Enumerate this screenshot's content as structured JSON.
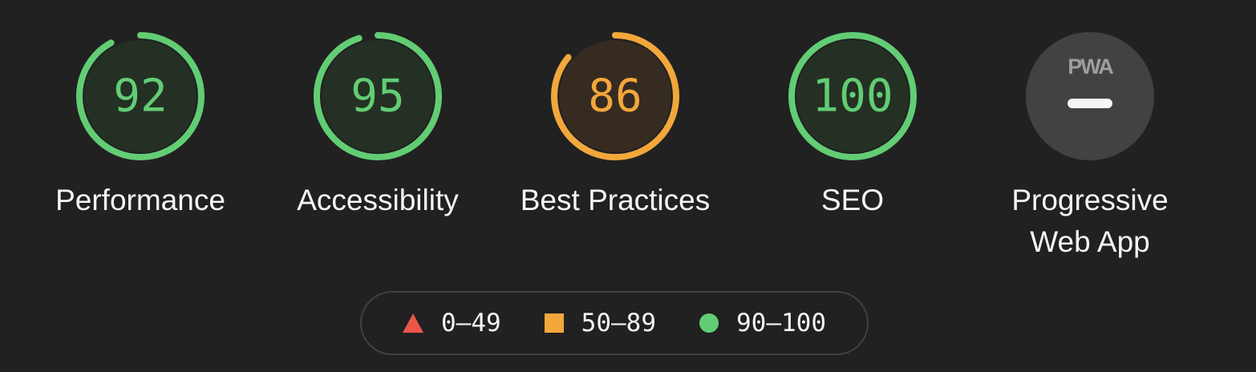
{
  "categories": [
    {
      "key": "performance",
      "label": "Performance",
      "score": 92,
      "display": "92",
      "color": "#62cd74",
      "fill": "#243024"
    },
    {
      "key": "accessibility",
      "label": "Accessibility",
      "score": 95,
      "display": "95",
      "color": "#62cd74",
      "fill": "#243024"
    },
    {
      "key": "best-practices",
      "label": "Best Practices",
      "score": 86,
      "display": "86",
      "color": "#f2a73b",
      "fill": "#352b21"
    },
    {
      "key": "seo",
      "label": "SEO",
      "score": 100,
      "display": "100",
      "color": "#62cd74",
      "fill": "#243024"
    }
  ],
  "pwa": {
    "label": "Progressive\nWeb App",
    "badge_text": "PWA",
    "status": "not-applicable",
    "color": "#424242"
  },
  "legend": [
    {
      "shape": "triangle",
      "range": "0–49",
      "color": "#eb5649"
    },
    {
      "shape": "square",
      "range": "50–89",
      "color": "#f2a73b"
    },
    {
      "shape": "circle",
      "range": "90–100",
      "color": "#62cd74"
    }
  ]
}
